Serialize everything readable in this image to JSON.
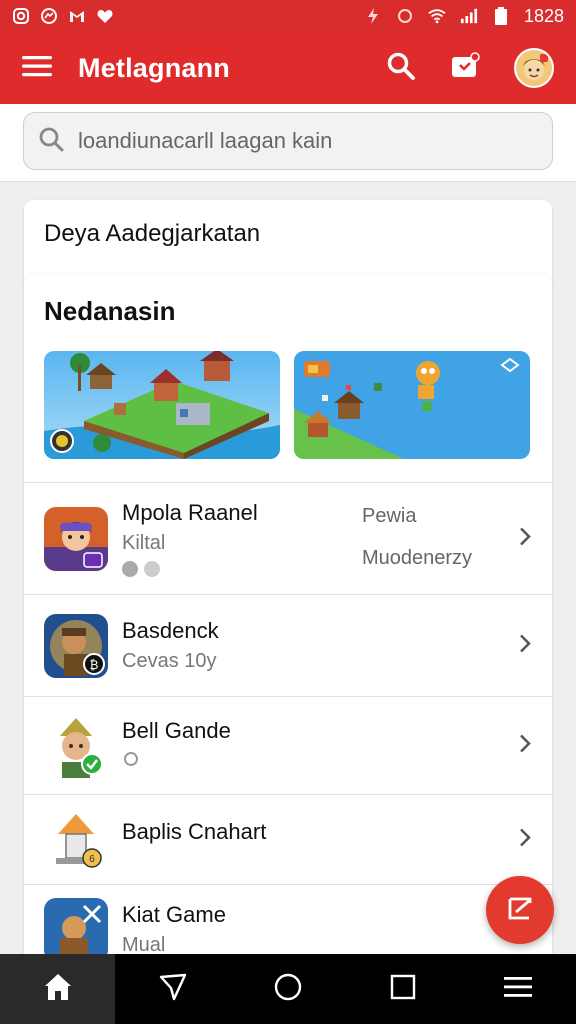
{
  "status_bar": {
    "time": "1828",
    "left_icons": [
      "instagram-icon",
      "messenger-icon",
      "gmail-icon",
      "heart-icon"
    ],
    "right_icons": [
      "flash-icon",
      "vibrate-icon",
      "wifi-icon",
      "signal-icon",
      "battery-icon"
    ]
  },
  "app_bar": {
    "title": "Metlagnann"
  },
  "search": {
    "placeholder": "loandiunacarll laagan kain"
  },
  "section_card": {
    "label": "Deya Aadegjarkatan"
  },
  "featured": {
    "heading": "Nedanasin",
    "banners": [
      {
        "name": "island-village"
      },
      {
        "name": "island-fields"
      }
    ]
  },
  "items": [
    {
      "name": "Mpola Raanel",
      "sub": "Kiltal",
      "meta_top": "Pewia",
      "meta_bottom": "Muodenerzy"
    },
    {
      "name": "Basdenck",
      "sub": "Cevas 10y"
    },
    {
      "name": "Bell Gande",
      "sub": ""
    },
    {
      "name": "Baplis Cnahart",
      "sub": ""
    },
    {
      "name": "Kiat Game",
      "sub": "Mual"
    }
  ],
  "colors": {
    "accent": "#df2b2b",
    "fab": "#e23a2e",
    "background": "#efefef"
  },
  "bottom_nav": [
    "home-icon",
    "send-icon",
    "circle-icon",
    "square-icon",
    "menu-icon"
  ]
}
